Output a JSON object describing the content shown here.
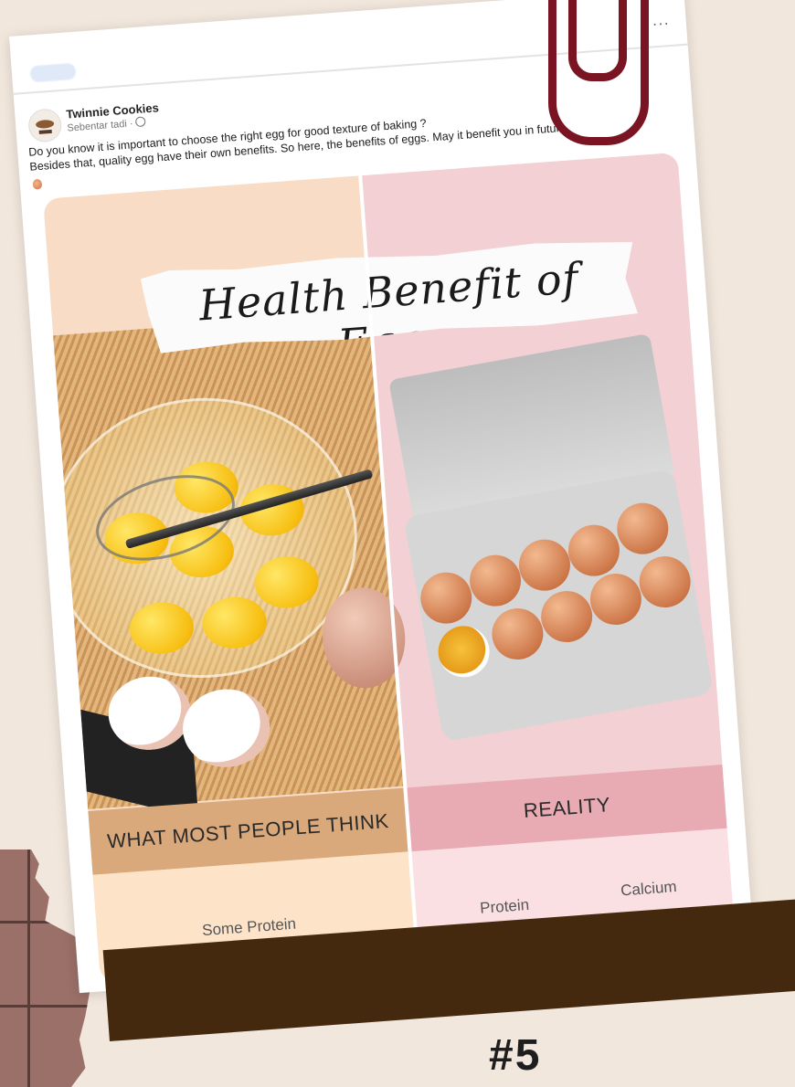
{
  "post": {
    "author": "Twinnie Cookies",
    "timestamp": "Sebentar tadi · ",
    "globe_icon": "globe-icon",
    "more_icon": "···",
    "caption_line1": "Do you know it is important to choose the right egg for good texture of baking ?",
    "caption_line2": "Besides that, quality egg have their own benefits. So here, the benefits of eggs. May it benefit you in future."
  },
  "infographic": {
    "title": "Health Benefit of Eggs",
    "left_banner": "WHAT MOST PEOPLE THINK",
    "right_banner": "REALITY",
    "left_stats": [
      "Some Protein"
    ],
    "right_stats": [
      "Protein",
      "Calcium"
    ]
  },
  "page": {
    "bottom_number": "#5"
  },
  "colors": {
    "background": "#f1e7dc",
    "brown_bar": "#45290f",
    "paper_clip": "#7a1423"
  }
}
